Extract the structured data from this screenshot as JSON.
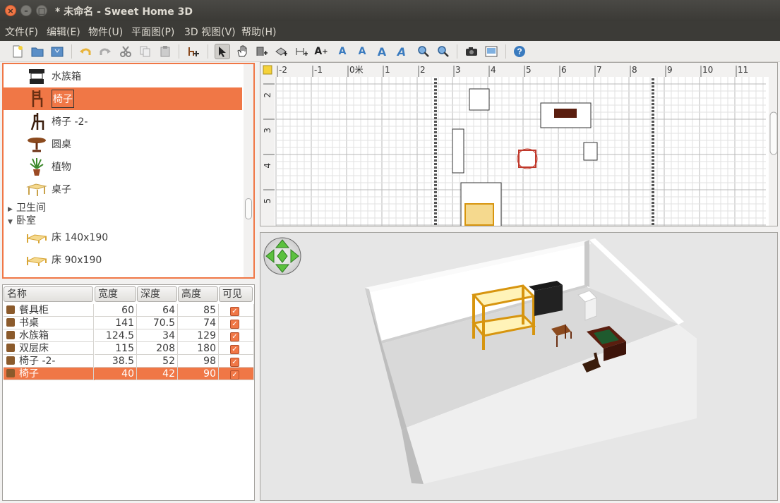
{
  "window": {
    "title": "* 未命名 - Sweet Home 3D"
  },
  "menubar": [
    "文件(F)",
    "编辑(E)",
    "物件(U)",
    "平面图(P)",
    "3D 视图(V)",
    "帮助(H)"
  ],
  "toolbar": {
    "icons": [
      "new-file-icon",
      "open-icon",
      "save-icon",
      "undo-icon",
      "redo-icon",
      "cut-icon",
      "copy-icon",
      "paste-icon",
      "add-furniture-icon",
      "select-arrow-icon",
      "pan-hand-icon",
      "create-walls-icon",
      "create-rooms-icon",
      "create-dimensions-icon",
      "add-text-icon",
      "text-style-a1-icon",
      "text-style-a2-icon",
      "bold-text-icon",
      "italic-text-icon",
      "zoom-in-icon",
      "zoom-out-icon",
      "camera-icon",
      "virtual-visit-icon",
      "help-icon"
    ]
  },
  "catalog": {
    "items": [
      {
        "label": "水族箱",
        "icon": "aquarium-icon"
      },
      {
        "label": "椅子",
        "icon": "chair-icon",
        "selected": true
      },
      {
        "label": "椅子 -2-",
        "icon": "chair-icon"
      },
      {
        "label": "圆桌",
        "icon": "round-table-icon"
      },
      {
        "label": "植物",
        "icon": "plant-icon"
      },
      {
        "label": "桌子",
        "icon": "table-icon"
      }
    ],
    "groups": [
      {
        "label": "卫生间",
        "expanded": false
      },
      {
        "label": "卧室",
        "expanded": true
      }
    ],
    "bedroom_items": [
      {
        "label": "床 140x190",
        "icon": "bed-icon"
      },
      {
        "label": "床 90x190",
        "icon": "bed-icon"
      }
    ]
  },
  "furniture_table": {
    "columns": [
      "名称",
      "宽度",
      "深度",
      "高度",
      "可见"
    ],
    "rows": [
      {
        "name": "餐具柜",
        "width": "60",
        "depth": "64",
        "height": "85",
        "visible": true
      },
      {
        "name": "书桌",
        "width": "141",
        "depth": "70.5",
        "height": "74",
        "visible": true
      },
      {
        "name": "水族箱",
        "width": "124.5",
        "depth": "34",
        "height": "129",
        "visible": true
      },
      {
        "name": "双层床",
        "width": "115",
        "depth": "208",
        "height": "180",
        "visible": true
      },
      {
        "name": "椅子 -2-",
        "width": "38.5",
        "depth": "52",
        "height": "98",
        "visible": true
      },
      {
        "name": "椅子",
        "width": "40",
        "depth": "42",
        "height": "90",
        "visible": true,
        "selected": true
      }
    ]
  },
  "plan": {
    "x_ticks": [
      "-2",
      "-1",
      "0米",
      "1",
      "2",
      "3",
      "4",
      "5",
      "6",
      "7",
      "8",
      "9",
      "10",
      "11"
    ],
    "y_ticks": [
      "2",
      "3",
      "4",
      "5"
    ]
  },
  "colors": {
    "accent": "#f07746",
    "titlebar": "#3c3b37"
  }
}
